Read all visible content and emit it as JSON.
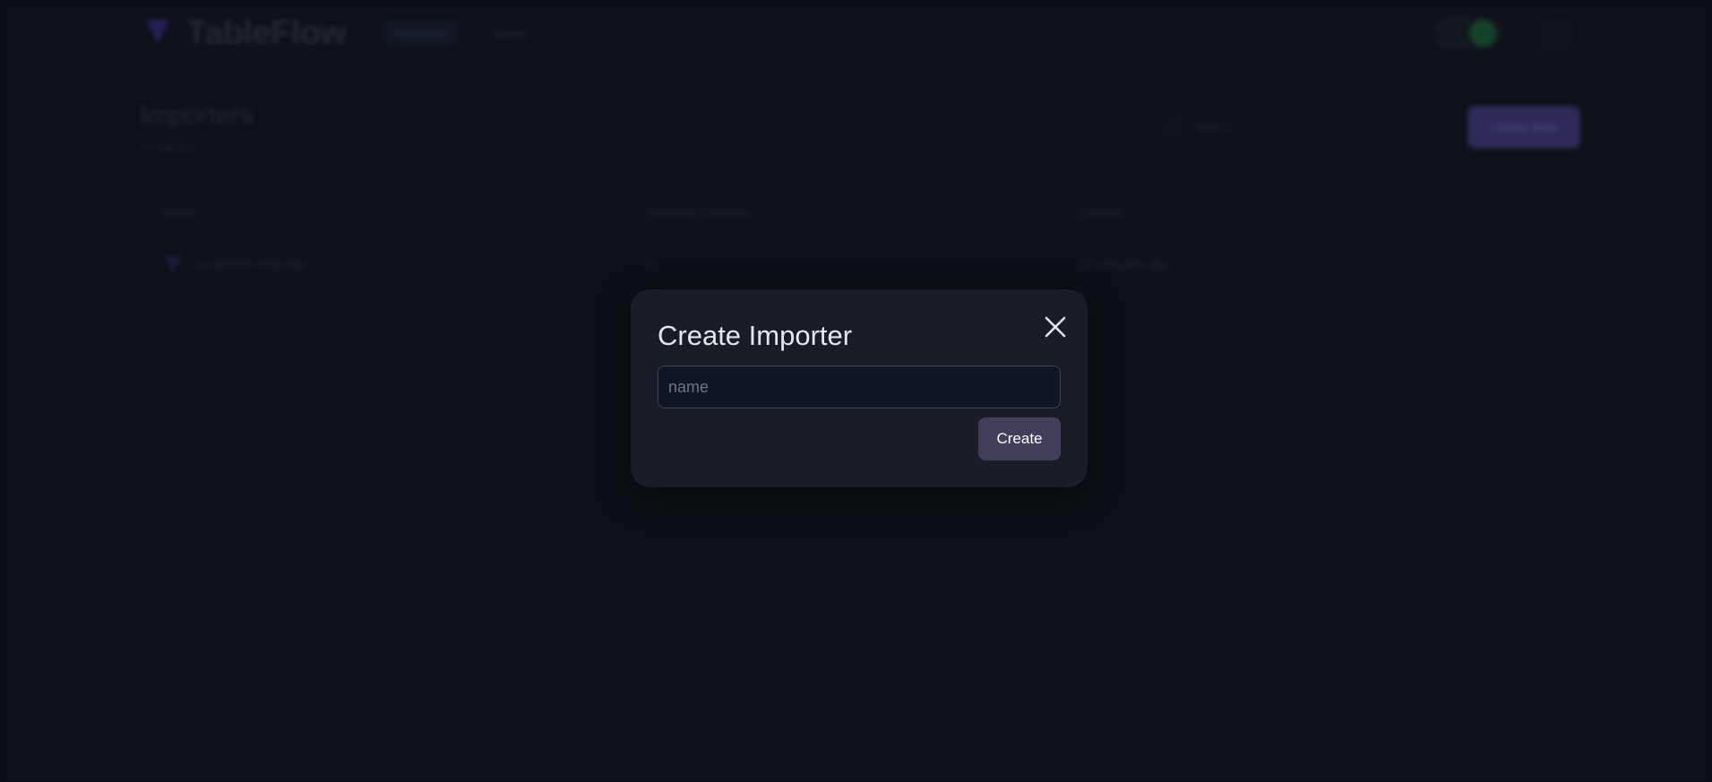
{
  "background": {
    "app_name": "TableFlow",
    "nav": {
      "tab_importers": "Importers",
      "tab_users": "Users"
    },
    "page_title": "Importers",
    "page_subtitle": "1 importer",
    "search_placeholder": "Search",
    "create_new_label": "Create New",
    "table": {
      "headers": [
        "Name",
        "Template Columns",
        "Created"
      ],
      "rows": [
        {
          "name": "Customer Importer",
          "columns": "0",
          "created": "12 minutes ago"
        }
      ]
    },
    "colors": {
      "background": "#0e1117",
      "accent": "#4a3f8e",
      "status_green": "#1d6b3a"
    }
  },
  "modal": {
    "title": "Create Importer",
    "close_icon": "close-icon",
    "name_input": {
      "placeholder": "name",
      "value": ""
    },
    "create_label": "Create",
    "colors": {
      "panel": "#1a1d25",
      "input_bg": "#101624",
      "button_bg": "#443d5c"
    }
  }
}
